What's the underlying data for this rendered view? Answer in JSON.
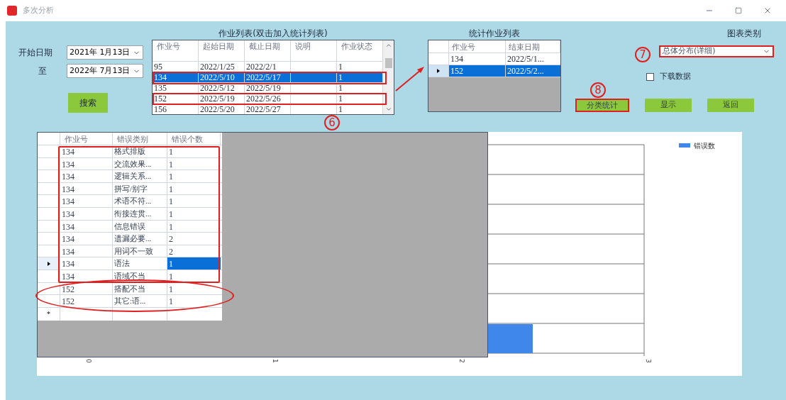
{
  "window": {
    "title": "多次分析"
  },
  "date_filter": {
    "start_label": "开始日期",
    "start_value": "2021年 1月13日",
    "end_label": "至",
    "end_value": "2022年 7月13日"
  },
  "search_button": "搜索",
  "job_list": {
    "title": "作业列表(双击加入统计列表)",
    "columns": [
      "作业号",
      "起始日期",
      "截止日期",
      "说明",
      "作业状态"
    ],
    "rows": [
      {
        "job_no": "95",
        "start": "2022/1/25",
        "end": "2022/2/1",
        "status": "1",
        "selected": false
      },
      {
        "job_no": "134",
        "start": "2022/5/10",
        "end": "2022/5/17",
        "status": "1",
        "selected": true
      },
      {
        "job_no": "135",
        "start": "2022/5/12",
        "end": "2022/5/19",
        "status": "1",
        "selected": false
      },
      {
        "job_no": "152",
        "start": "2022/5/19",
        "end": "2022/5/26",
        "status": "1",
        "selected": false
      },
      {
        "job_no": "156",
        "start": "2022/5/20",
        "end": "2022/5/27",
        "status": "1",
        "selected": false
      }
    ]
  },
  "stat_list": {
    "title": "统计作业列表",
    "columns": [
      "作业号",
      "结束日期"
    ],
    "rows": [
      {
        "job_no": "134",
        "end": "2022/5/1...",
        "selected": false,
        "current": false
      },
      {
        "job_no": "152",
        "end": "2022/5/2...",
        "selected": true,
        "current": true
      }
    ]
  },
  "chart_type": {
    "label": "图表类别",
    "value": "总体分布(详细)"
  },
  "download": {
    "label": "下载数据",
    "checked": false
  },
  "buttons": [
    "分类统计",
    "显示",
    "返回"
  ],
  "result_grid": {
    "columns": [
      "作业号",
      "错误类别",
      "错误个数"
    ],
    "rows": [
      {
        "job_no": "134",
        "category": "格式排版",
        "count": "1",
        "current": false,
        "selected": false
      },
      {
        "job_no": "134",
        "category": "交流效果...",
        "count": "1",
        "current": false,
        "selected": false
      },
      {
        "job_no": "134",
        "category": "逻辑关系...",
        "count": "1",
        "current": false,
        "selected": false
      },
      {
        "job_no": "134",
        "category": "拼写/别字",
        "count": "1",
        "current": false,
        "selected": false
      },
      {
        "job_no": "134",
        "category": "术语不符...",
        "count": "1",
        "current": false,
        "selected": false
      },
      {
        "job_no": "134",
        "category": "衔接连贯...",
        "count": "1",
        "current": false,
        "selected": false
      },
      {
        "job_no": "134",
        "category": "信息错误",
        "count": "1",
        "current": false,
        "selected": false
      },
      {
        "job_no": "134",
        "category": "遗漏必要...",
        "count": "2",
        "current": false,
        "selected": false
      },
      {
        "job_no": "134",
        "category": "用词不一致",
        "count": "2",
        "current": false,
        "selected": false
      },
      {
        "job_no": "134",
        "category": "语法",
        "count": "1",
        "current": true,
        "selected": true
      },
      {
        "job_no": "134",
        "category": "语域不当",
        "count": "1",
        "current": false,
        "selected": false
      },
      {
        "job_no": "152",
        "category": "搭配不当",
        "count": "1",
        "current": false,
        "selected": false
      },
      {
        "job_no": "152",
        "category": "其它:语...",
        "count": "1",
        "current": false,
        "selected": false
      }
    ],
    "new_row_marker": "*"
  },
  "chart": {
    "legend": "错误数",
    "x_ticks": [
      "0",
      "1",
      "2",
      "3"
    ]
  },
  "callouts": [
    "6",
    "7",
    "8"
  ]
}
